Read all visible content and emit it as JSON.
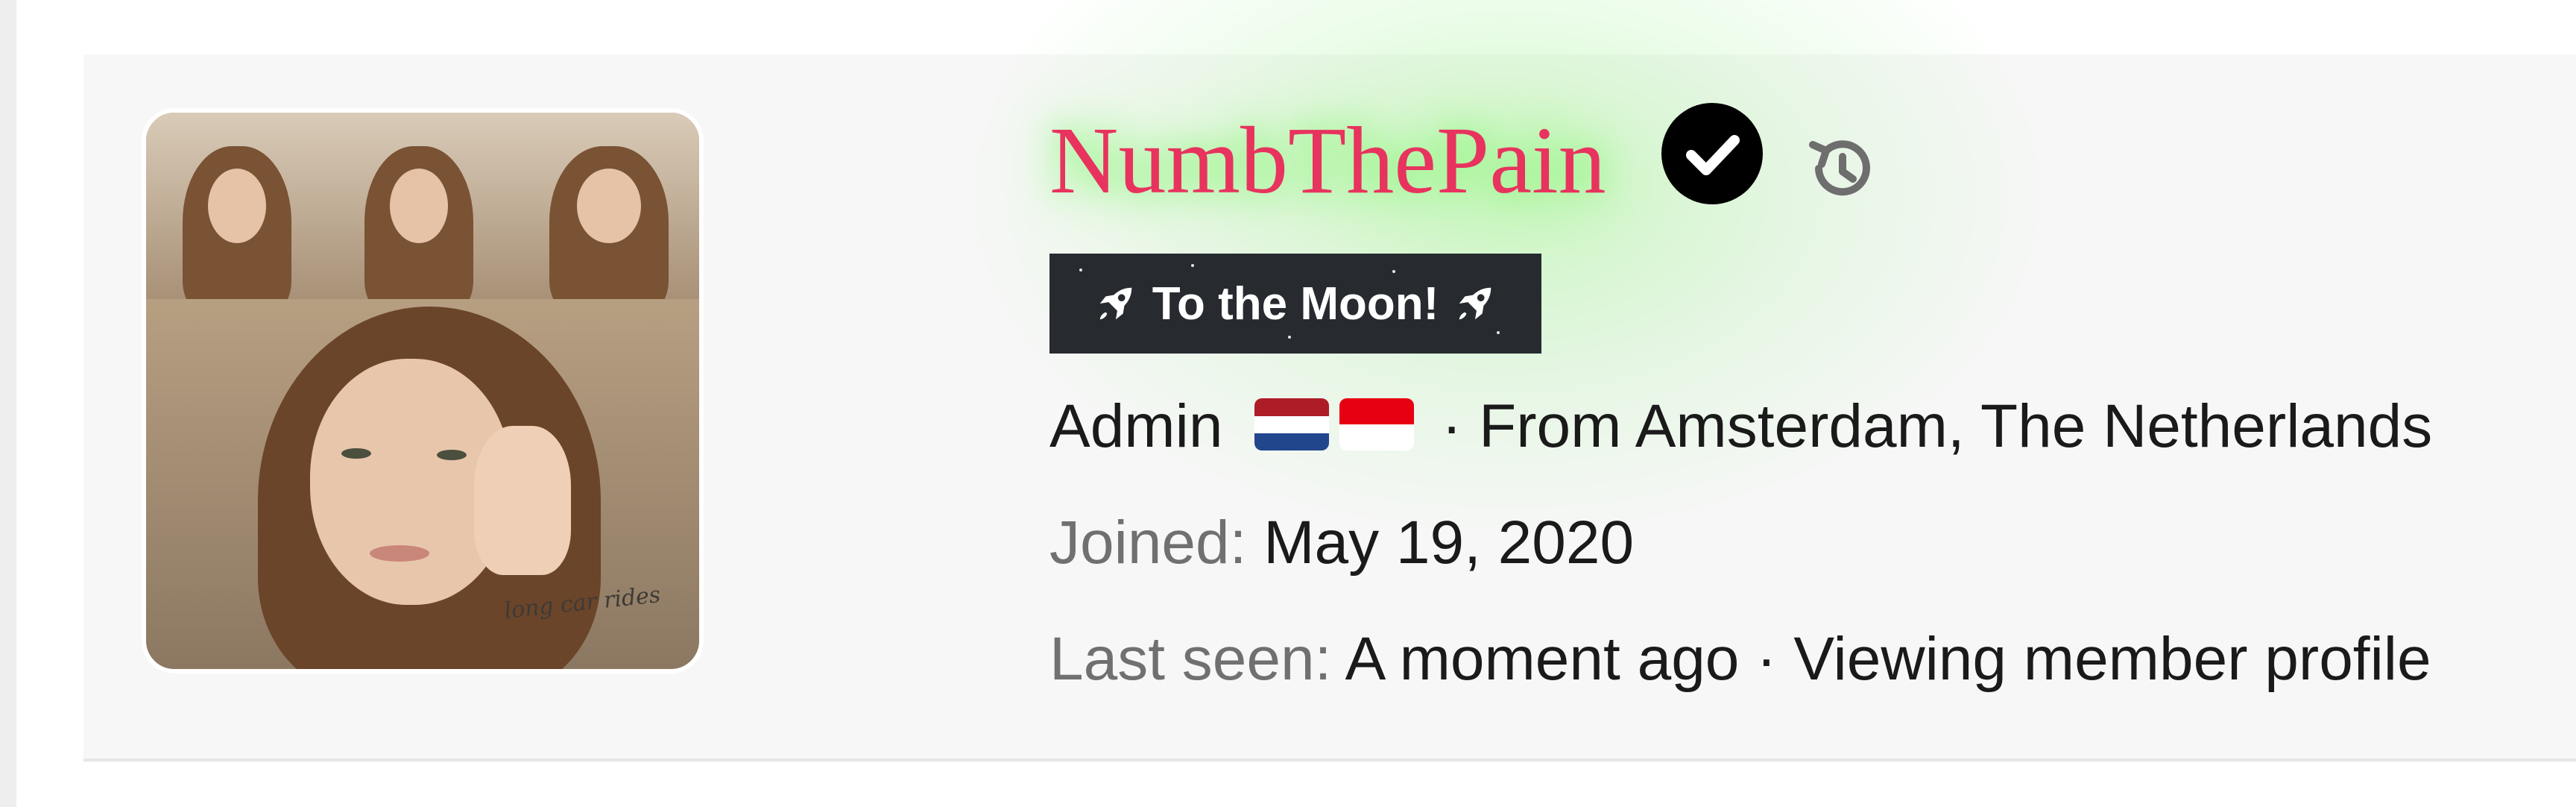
{
  "profile": {
    "username": "NumbThePain",
    "banner": "To the Moon!",
    "role": "Admin",
    "location_sep": "·",
    "location": "From Amsterdam, The Netherlands",
    "joined_label": "Joined:",
    "joined_value": "May 19, 2020",
    "last_seen_label": "Last seen:",
    "last_seen_value": "A moment ago",
    "activity_sep": "·",
    "activity": "Viewing member profile",
    "avatar_caption": "long car rides",
    "flags": [
      "netherlands-flag",
      "indonesia-flag"
    ],
    "icons": {
      "verified": "verified-check-icon",
      "history": "history-icon",
      "rocket": "rocket-icon"
    }
  },
  "colors": {
    "username": "#e8335e",
    "banner_bg": "#272b30",
    "glow": "#8cf578",
    "card_bg": "#f7f7f7",
    "muted_text": "#707070"
  }
}
